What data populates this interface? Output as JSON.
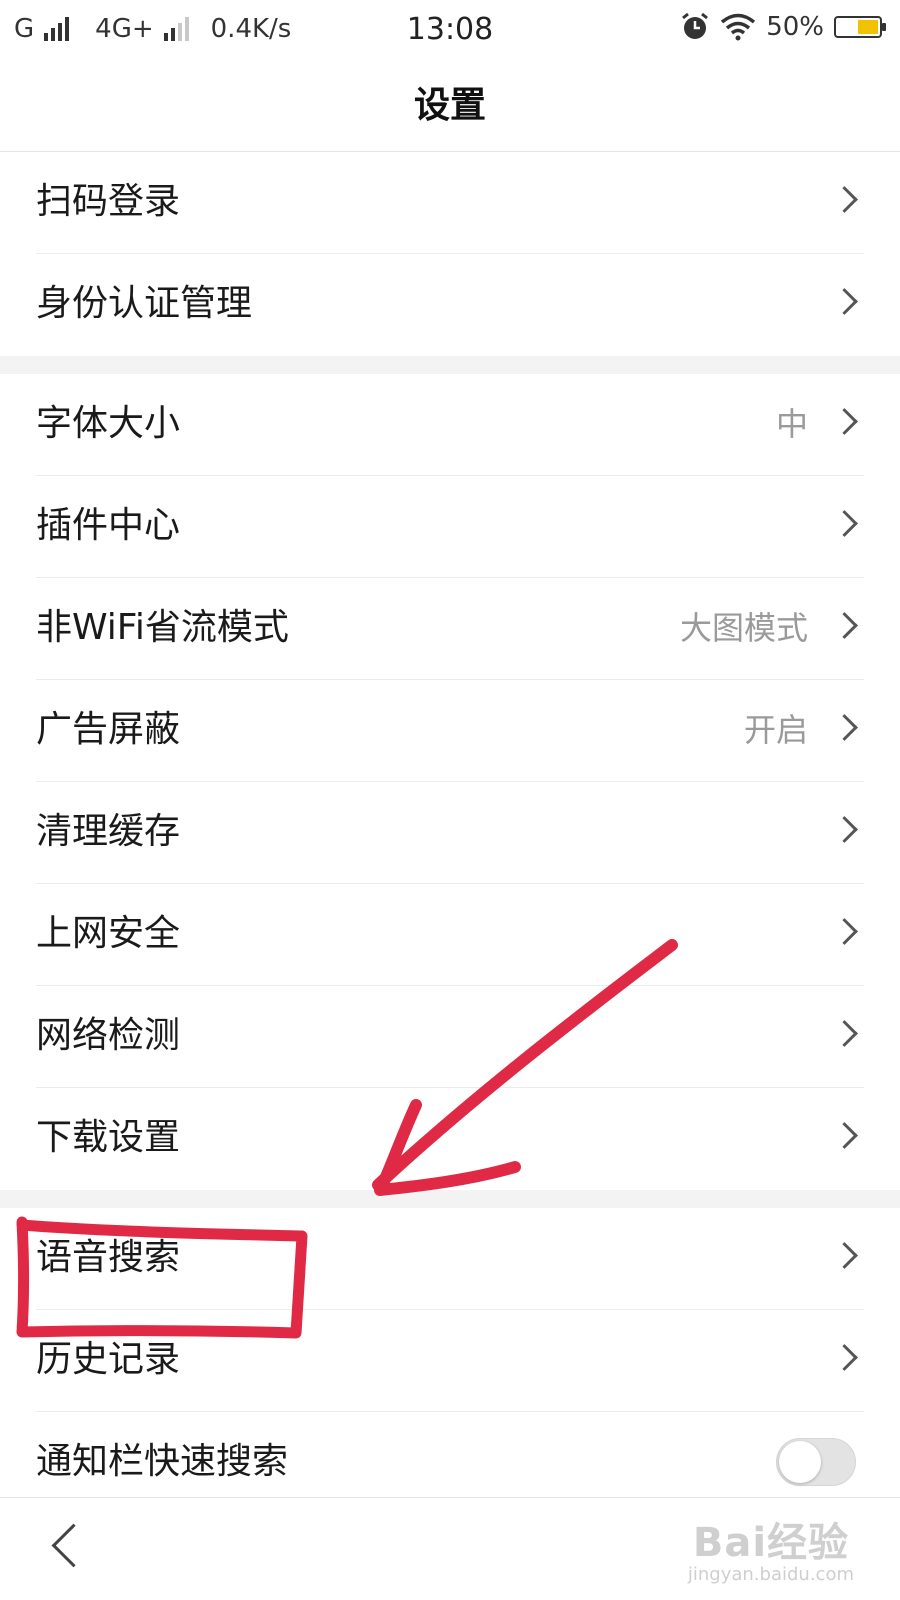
{
  "status_bar": {
    "carrier1": "G",
    "carrier2": "4G+",
    "speed": "0.4K/s",
    "time": "13:08",
    "battery": "50%",
    "battery_level": 0.5,
    "accent_battery": "#f2c200"
  },
  "header": {
    "title": "设置"
  },
  "groups": [
    {
      "items": [
        {
          "label": "扫码登录",
          "value": "",
          "control": "chevron"
        },
        {
          "label": "身份认证管理",
          "value": "",
          "control": "chevron"
        }
      ]
    },
    {
      "items": [
        {
          "label": "字体大小",
          "value": "中",
          "control": "chevron"
        },
        {
          "label": "插件中心",
          "value": "",
          "control": "chevron"
        },
        {
          "label": "非WiFi省流模式",
          "value": "大图模式",
          "control": "chevron"
        },
        {
          "label": "广告屏蔽",
          "value": "开启",
          "control": "chevron"
        },
        {
          "label": "清理缓存",
          "value": "",
          "control": "chevron"
        },
        {
          "label": "上网安全",
          "value": "",
          "control": "chevron"
        },
        {
          "label": "网络检测",
          "value": "",
          "control": "chevron"
        },
        {
          "label": "下载设置",
          "value": "",
          "control": "chevron"
        }
      ]
    },
    {
      "items": [
        {
          "label": "语音搜索",
          "value": "",
          "control": "chevron"
        },
        {
          "label": "历史记录",
          "value": "",
          "control": "chevron"
        },
        {
          "label": "通知栏快速搜索",
          "value": "",
          "control": "toggle",
          "toggle_on": false
        }
      ]
    }
  ],
  "bottom_bar": {
    "back_icon": "chevron-left-icon"
  },
  "watermark": {
    "line1": "Bai经验",
    "line2": "jingyan.baidu.com"
  },
  "annotation": {
    "color": "#e02a45"
  }
}
